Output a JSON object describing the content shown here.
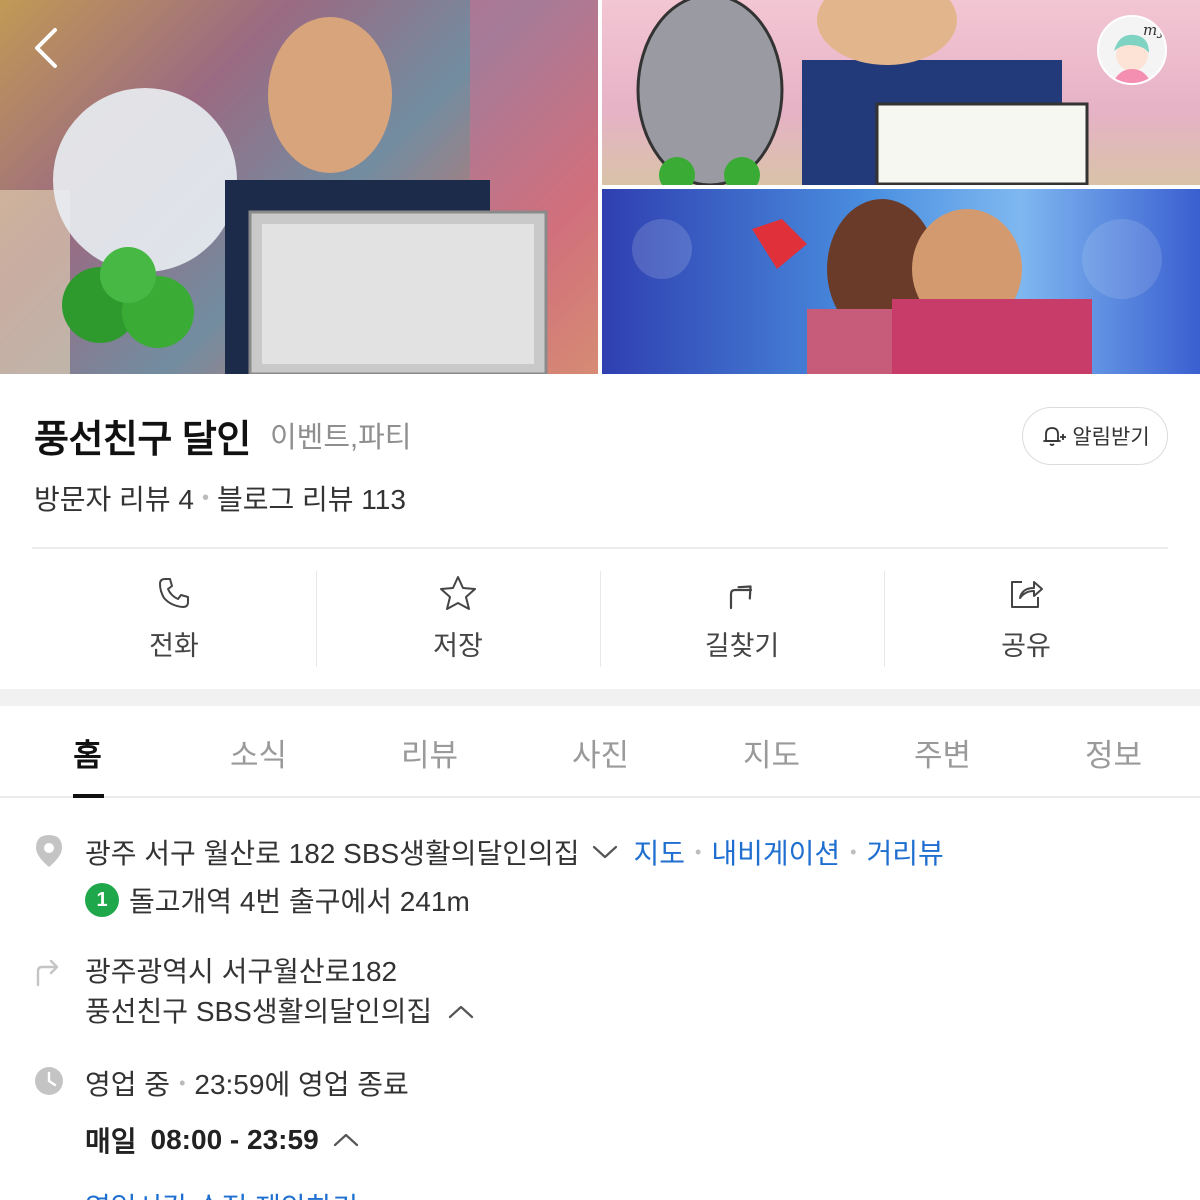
{
  "header": {
    "photos": [
      {
        "name": "main-photo"
      },
      {
        "name": "illustration-photo"
      },
      {
        "name": "stage-photo"
      }
    ]
  },
  "place": {
    "name": "풍선친구 달인",
    "category": "이벤트,파티",
    "alarm_label": "알림받기",
    "visitor_reviews": "방문자 리뷰 4",
    "blog_reviews": "블로그 리뷰 113"
  },
  "actions": [
    {
      "label": "전화",
      "icon": "phone-icon"
    },
    {
      "label": "저장",
      "icon": "star-icon"
    },
    {
      "label": "길찾기",
      "icon": "directions-icon"
    },
    {
      "label": "공유",
      "icon": "share-icon"
    }
  ],
  "tabs": [
    {
      "label": "홈",
      "active": true
    },
    {
      "label": "소식",
      "active": false
    },
    {
      "label": "리뷰",
      "active": false
    },
    {
      "label": "사진",
      "active": false
    },
    {
      "label": "지도",
      "active": false
    },
    {
      "label": "주변",
      "active": false
    },
    {
      "label": "정보",
      "active": false
    }
  ],
  "detail": {
    "address": "광주 서구 월산로 182 SBS생활의달인의집",
    "links": [
      "지도",
      "내비게이션",
      "거리뷰"
    ],
    "subway_line": "1",
    "subway_text": "돌고개역 4번 출구에서 241m",
    "directions_line1": "광주광역시 서구월산로182",
    "directions_line2": "풍선친구 SBS생활의달인의집",
    "status": "영업 중",
    "status_detail": "23:59에 영업 종료",
    "daily_label": "매일",
    "daily_hours": "08:00 - 23:59",
    "cutoff_text": "영업시간 수정 제안하기"
  },
  "colors": {
    "link": "#1e6fd0",
    "subway_line_1": "#1fa84b",
    "text_primary": "#111111",
    "text_muted": "#8f8f8f"
  }
}
